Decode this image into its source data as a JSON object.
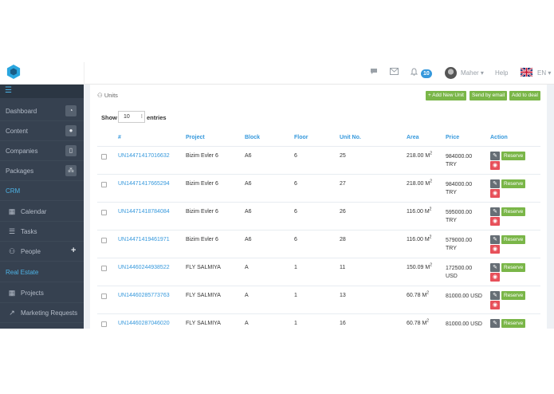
{
  "header": {
    "notification_count": "10",
    "user_name": "Maher",
    "help_label": "Help",
    "language": "EN",
    "icons": [
      "chat-icon",
      "mail-icon",
      "bell-icon",
      "flag-uk-icon"
    ]
  },
  "sidebar": {
    "items": [
      {
        "label": "Dashboard",
        "icon": "dashboard-icon"
      },
      {
        "label": "Content",
        "icon": "globe-icon"
      },
      {
        "label": "Companies",
        "icon": "mobile-icon"
      },
      {
        "label": "Packages",
        "icon": "cubes-icon"
      },
      {
        "label": "CRM",
        "section": true
      },
      {
        "label": "Calendar",
        "icon": "calendar-icon"
      },
      {
        "label": "Tasks",
        "icon": "tasks-icon"
      },
      {
        "label": "People",
        "icon": "users-icon"
      },
      {
        "label": "Real Estate",
        "section": true
      },
      {
        "label": "Projects",
        "icon": "grid-icon"
      },
      {
        "label": "Marketing Requests",
        "icon": "share-icon"
      }
    ]
  },
  "page": {
    "breadcrumb": "Units",
    "add_unit": "+ Add New Unit",
    "send_email": "Send by email",
    "add_to_deal": "Add to deal",
    "show_label": "Show",
    "entries_value": "10",
    "entries_label": "entries"
  },
  "table": {
    "columns": [
      "#",
      "Project",
      "Block",
      "Floor",
      "Unit No.",
      "Area",
      "Price",
      "Action"
    ],
    "reserve_label": "Reserve",
    "rows": [
      {
        "id": "UN14471417016632",
        "project": "Bizim Evler 6",
        "block": "A6",
        "floor": "6",
        "unit": "25",
        "area": "218.00 M",
        "price_line1": "984000.00",
        "price_line2": "TRY"
      },
      {
        "id": "UN14471417665294",
        "project": "Bizim Evler 6",
        "block": "A6",
        "floor": "6",
        "unit": "27",
        "area": "218.00 M",
        "price_line1": "984000.00",
        "price_line2": "TRY"
      },
      {
        "id": "UN14471418784084",
        "project": "Bizim Evler 6",
        "block": "A6",
        "floor": "6",
        "unit": "26",
        "area": "116.00 M",
        "price_line1": "595000.00",
        "price_line2": "TRY"
      },
      {
        "id": "UN14471419461971",
        "project": "Bizim Evler 6",
        "block": "A6",
        "floor": "6",
        "unit": "28",
        "area": "116.00 M",
        "price_line1": "579000.00",
        "price_line2": "TRY"
      },
      {
        "id": "UN14460244938522",
        "project": "FLY SALMIYA",
        "block": "A",
        "floor": "1",
        "unit": "11",
        "area": "150.09 M",
        "price_line1": "172500.00",
        "price_line2": "USD"
      },
      {
        "id": "UN14460285773763",
        "project": "FLY SALMIYA",
        "block": "A",
        "floor": "1",
        "unit": "13",
        "area": "60.78 M",
        "price_line1": "81000.00 USD",
        "price_line2": ""
      },
      {
        "id": "UN14460287046020",
        "project": "FLY SALMIYA",
        "block": "A",
        "floor": "1",
        "unit": "16",
        "area": "60.78 M",
        "price_line1": "81000.00 USD",
        "price_line2": ""
      }
    ]
  },
  "colors": {
    "accent": "#3598dc",
    "green": "#7ab648",
    "red": "#e7505a",
    "sidebar": "#364150"
  }
}
